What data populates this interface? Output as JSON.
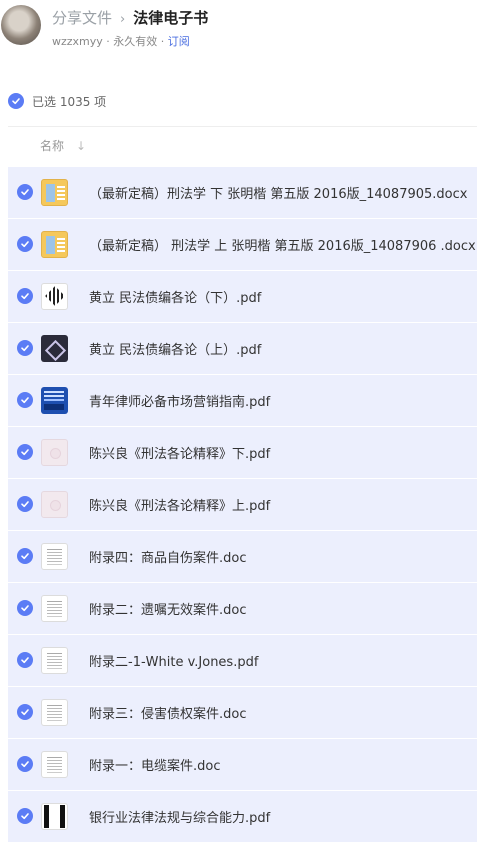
{
  "header": {
    "breadcrumb_parent": "分享文件",
    "breadcrumb_separator": "›",
    "title": "法律电子书",
    "owner": "wzzxmyy",
    "meta_sep1": " · ",
    "validity": "永久有效",
    "meta_sep2": " · ",
    "subscribe": "订阅"
  },
  "selection": {
    "label": "已选 1035 项"
  },
  "column": {
    "name_label": "名称",
    "sort_icon": "↓"
  },
  "files": [
    {
      "name": "（最新定稿）刑法学 下 张明楷 第五版 2016版_14087905.docx",
      "thumb": "docx"
    },
    {
      "name": "（最新定稿） 刑法学 上 张明楷 第五版 2016版_14087906 .docx",
      "thumb": "docx"
    },
    {
      "name": "黄立 民法债编各论（下）.pdf",
      "thumb": "pattern"
    },
    {
      "name": "黄立 民法债编各论（上）.pdf",
      "thumb": "dark"
    },
    {
      "name": "青年律师必备市场营销指南.pdf",
      "thumb": "blue"
    },
    {
      "name": "陈兴良《刑法各论精释》下.pdf",
      "thumb": "pink"
    },
    {
      "name": "陈兴良《刑法各论精释》上.pdf",
      "thumb": "pink"
    },
    {
      "name": "附录四：商品自伤案件.doc",
      "thumb": "page"
    },
    {
      "name": "附录二：遗嘱无效案件.doc",
      "thumb": "page"
    },
    {
      "name": "附录二-1-White v.Jones.pdf",
      "thumb": "page"
    },
    {
      "name": "附录三：侵害债权案件.doc",
      "thumb": "page"
    },
    {
      "name": "附录一：电缆案件.doc",
      "thumb": "page"
    },
    {
      "name": "银行业法律法规与综合能力.pdf",
      "thumb": "bwcover"
    }
  ],
  "colors": {
    "accent": "#5b7cf5",
    "row_bg": "#eceffd",
    "link": "#4a6ee0"
  }
}
